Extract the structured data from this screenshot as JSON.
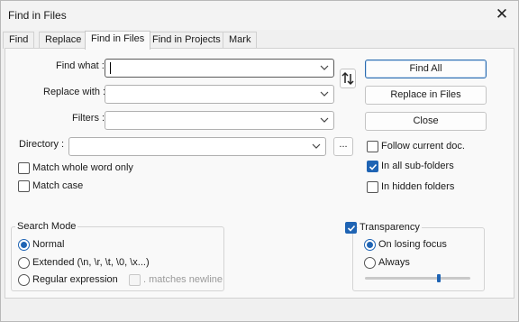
{
  "window": {
    "title": "Find in Files"
  },
  "tabs": [
    {
      "label": "Find"
    },
    {
      "label": "Replace"
    },
    {
      "label": "Find in Files"
    },
    {
      "label": "Find in Projects"
    },
    {
      "label": "Mark"
    }
  ],
  "active_tab": "Find in Files",
  "fields": {
    "find_what": {
      "label": "Find what :",
      "value": ""
    },
    "replace_with": {
      "label": "Replace with :",
      "value": ""
    },
    "filters": {
      "label": "Filters :",
      "value": ""
    },
    "directory": {
      "label": "Directory :",
      "value": "",
      "browse_label": "..."
    }
  },
  "buttons": {
    "find_all": "Find All",
    "replace_in_files": "Replace in Files",
    "close": "Close"
  },
  "options": {
    "match_whole_word": {
      "label": "Match whole word only",
      "checked": false
    },
    "match_case": {
      "label": "Match case",
      "checked": false
    },
    "follow_current_doc": {
      "label": "Follow current doc.",
      "checked": false
    },
    "in_all_subfolders": {
      "label": "In all sub-folders",
      "checked": true
    },
    "in_hidden_folders": {
      "label": "In hidden folders",
      "checked": false
    }
  },
  "search_mode": {
    "title": "Search Mode",
    "normal": {
      "label": "Normal",
      "selected": true
    },
    "extended": {
      "label": "Extended (\\n, \\r, \\t, \\0, \\x...)",
      "selected": false
    },
    "regex": {
      "label": "Regular expression",
      "selected": false
    },
    "matches_newline": {
      "label": ". matches newline",
      "checked": false,
      "enabled": false
    }
  },
  "transparency": {
    "title": "Transparency",
    "enabled": true,
    "on_losing_focus": {
      "label": "On losing focus",
      "selected": true
    },
    "always": {
      "label": "Always",
      "selected": false
    },
    "level": 0.7
  },
  "colors": {
    "accent": "#1f64b4",
    "window_bg": "#f0f0f0",
    "panel_bg": "#f9f9f9"
  }
}
